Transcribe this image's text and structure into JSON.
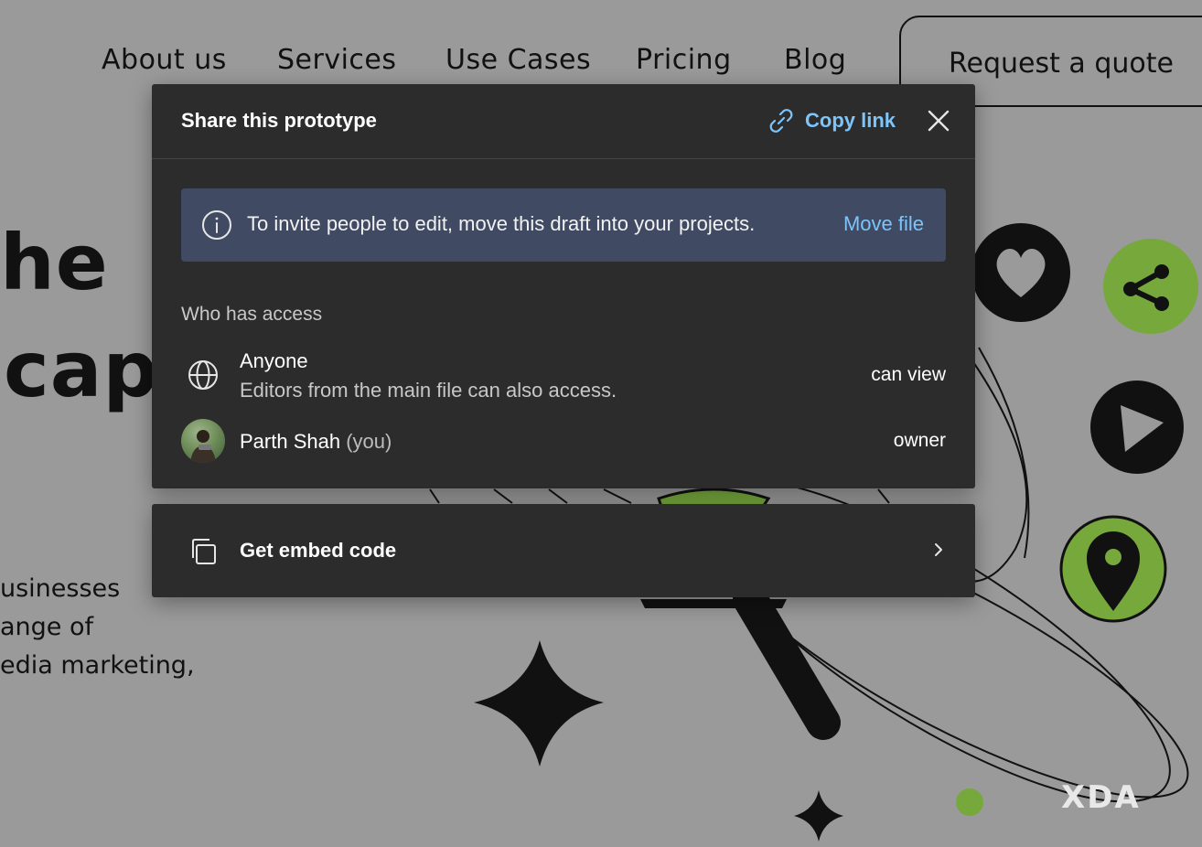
{
  "background": {
    "nav": [
      "About us",
      "Services",
      "Use Cases",
      "Pricing",
      "Blog"
    ],
    "quote_button": "Request a quote",
    "hero_lines": [
      "he",
      "cap"
    ],
    "body_lines": [
      "usinesses",
      "ange of",
      "edia marketing,"
    ],
    "watermark": "XDA"
  },
  "modal": {
    "title": "Share this prototype",
    "copy_link": "Copy link",
    "banner": {
      "text": "To invite people to edit, move this draft into your projects.",
      "link": "Move file"
    },
    "access_label": "Who has access",
    "access": [
      {
        "title": "Anyone",
        "subtitle": "Editors from the main file can also access.",
        "permission": "can view",
        "icon": "globe-icon"
      },
      {
        "name": "Parth Shah",
        "suffix": "(you)",
        "permission": "owner",
        "icon": "avatar"
      }
    ]
  },
  "embed": {
    "label": "Get embed code"
  },
  "colors": {
    "modal_bg": "#2c2c2c",
    "banner_bg": "#404a63",
    "link": "#7cc4fa",
    "accent_green": "#76a83c"
  }
}
